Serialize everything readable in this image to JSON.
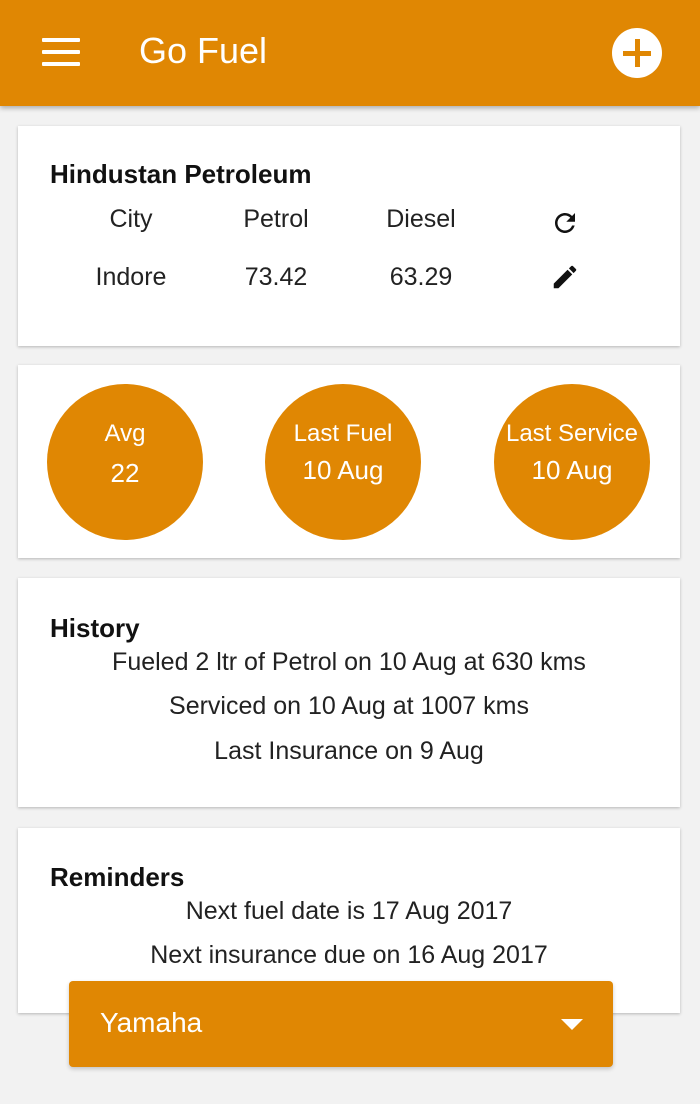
{
  "app": {
    "title": "Go Fuel"
  },
  "colors": {
    "accent": "#e08703",
    "background": "#f2f2f2"
  },
  "icons": {
    "menu": "menu-icon",
    "add": "add-circle-icon",
    "refresh": "refresh-icon",
    "edit": "pencil-icon",
    "dropdown": "chevron-down-icon"
  },
  "price_card": {
    "title": "Hindustan Petroleum",
    "headers": {
      "city": "City",
      "petrol": "Petrol",
      "diesel": "Diesel"
    },
    "values": {
      "city": "Indore",
      "petrol": "73.42",
      "diesel": "63.29"
    }
  },
  "stats": [
    {
      "label": "Avg",
      "value": "22"
    },
    {
      "label": "Last Fuel",
      "value": "10 Aug"
    },
    {
      "label": "Last Service",
      "value": "10 Aug"
    }
  ],
  "history": {
    "title": "History",
    "items": [
      "Fueled 2 ltr of Petrol on 10 Aug at 630 kms",
      "Serviced on 10 Aug at 1007 kms",
      "Last Insurance on 9 Aug"
    ]
  },
  "reminders": {
    "title": "Reminders",
    "items": [
      "Next fuel date is 17 Aug 2017",
      "Next insurance due on 16 Aug 2017"
    ]
  },
  "vehicle_select": {
    "value": "Yamaha"
  }
}
